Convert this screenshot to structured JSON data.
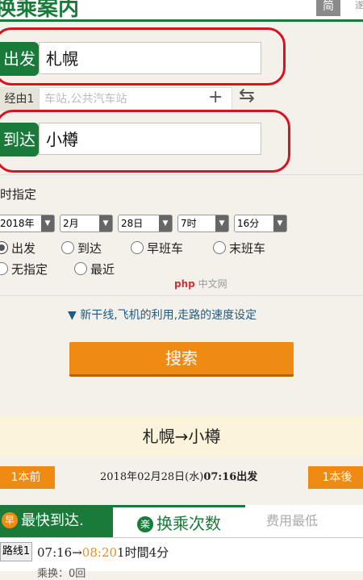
{
  "header": {
    "title": "换乘案内",
    "btn": "简",
    "tiny": "遂"
  },
  "form": {
    "depart_label": "出发",
    "depart_value": "札幌",
    "via_label": "经由1",
    "via_placeholder": "车站,公共汽车站",
    "arrive_label": "到达",
    "arrive_value": "小樽"
  },
  "datetime": {
    "title": "时指定",
    "year": "2018年",
    "month": "2月",
    "day": "28日",
    "hour": "7时",
    "minute": "16分",
    "radios": [
      "出发",
      "到达",
      "早班车",
      "末班车",
      "无指定",
      "最近"
    ],
    "selected": "出发"
  },
  "watermark": {
    "icon": "php",
    "text": "中文网"
  },
  "options_link": "▼ 新干线,飞机的利用,走路的速度设定",
  "search_label": "搜索",
  "result": {
    "route": "札幌→小樽",
    "prev": "1本前",
    "date_text": "2018年02月28日(水)",
    "date_bold": "07:16出发",
    "next": "1本後",
    "tab_fast_badge": "早",
    "tab_fast": "最快到达.",
    "tab_transfer_badge": "楽",
    "tab_transfer": "换乘次数",
    "tab_third": "费用最低",
    "line_label": "路线1",
    "time_start": "07:16→",
    "time_end": "08:20",
    "duration": "1时間4分",
    "sub": "乘换：0回"
  },
  "colors": {
    "brand_green": "#1a7a3a",
    "accent_orange": "#ef8a13",
    "annotation_red": "#d8121f"
  }
}
